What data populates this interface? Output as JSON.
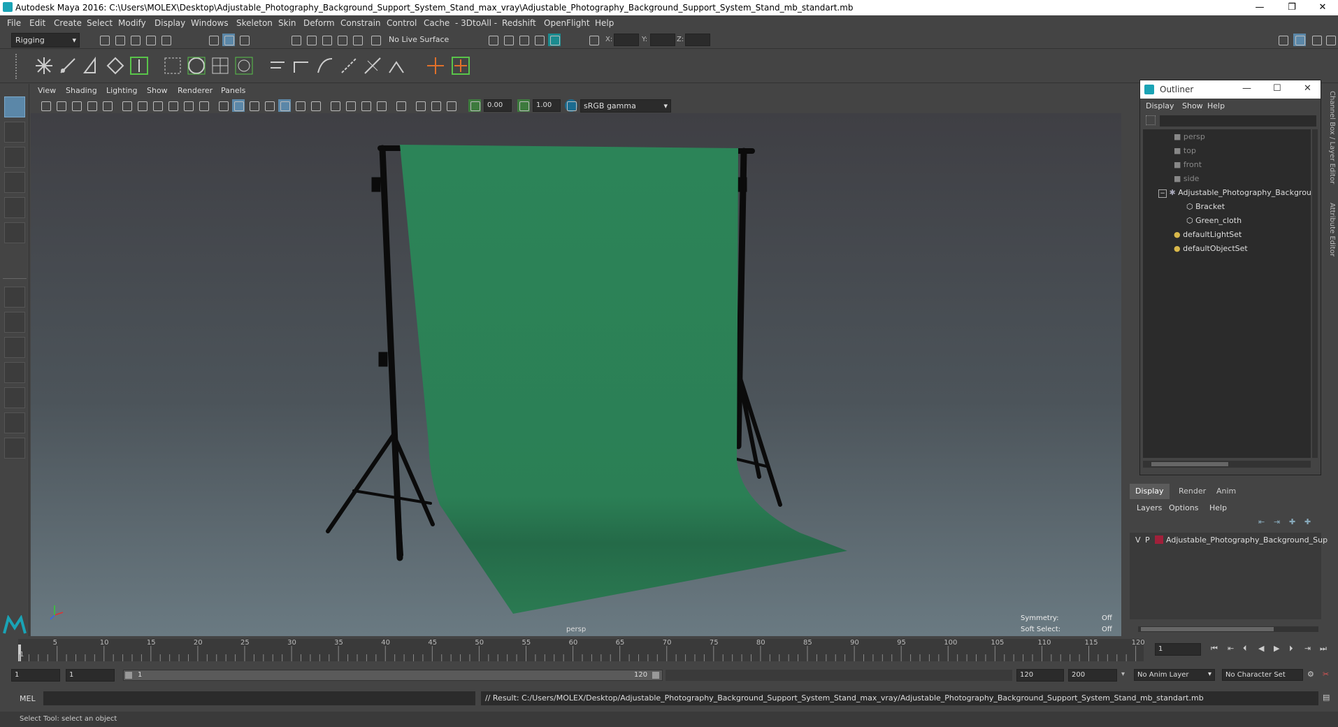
{
  "window": {
    "title": "Autodesk Maya 2016: C:\\Users\\MOLEX\\Desktop\\Adjustable_Photography_Background_Support_System_Stand_max_vray\\Adjustable_Photography_Background_Support_System_Stand_mb_standart.mb",
    "minimize": "—",
    "restore": "❐",
    "close": "✕"
  },
  "menubar": [
    "File",
    "Edit",
    "Create",
    "Select",
    "Modify",
    "Display",
    "Windows",
    "Skeleton",
    "Skin",
    "Deform",
    "Constrain",
    "Control",
    "Cache",
    "- 3DtoAll -",
    "Redshift",
    "OpenFlight",
    "Help"
  ],
  "statusline": {
    "menuset": "Rigging",
    "live_surface": "No Live Surface",
    "x_label": "X:",
    "y_label": "Y:",
    "z_label": "Z:"
  },
  "panel": {
    "menus": [
      "View",
      "Shading",
      "Lighting",
      "Show",
      "Renderer",
      "Panels"
    ],
    "exposure": "0.00",
    "gamma": "1.00",
    "colorspace": "sRGB gamma",
    "camera_label": "persp",
    "symmetry_label": "Symmetry:",
    "symmetry_value": "Off",
    "soft_select_label": "Soft Select:",
    "soft_select_value": "Off"
  },
  "outliner": {
    "title": "Outliner",
    "menus": [
      "Display",
      "Show",
      "Help"
    ],
    "items": [
      {
        "label": "persp",
        "dim": true
      },
      {
        "label": "top",
        "dim": true
      },
      {
        "label": "front",
        "dim": true
      },
      {
        "label": "side",
        "dim": true
      },
      {
        "label": "Adjustable_Photography_Backgrou",
        "dim": false
      },
      {
        "label": "Bracket",
        "dim": false
      },
      {
        "label": "Green_cloth",
        "dim": false
      },
      {
        "label": "defaultLightSet",
        "dim": false
      },
      {
        "label": "defaultObjectSet",
        "dim": false
      }
    ]
  },
  "side_tabs": {
    "channel_box": "Channel Box / Layer Editor",
    "attribute_editor": "Attribute Editor"
  },
  "layer_editor": {
    "tabs": [
      "Display",
      "Render",
      "Anim"
    ],
    "menus": [
      "Layers",
      "Options",
      "Help"
    ],
    "layer": {
      "v": "V",
      "p": "P",
      "name": "Adjustable_Photography_Background_Sup",
      "color": "#a0203a"
    }
  },
  "timeline": {
    "ticks": [
      "5",
      "10",
      "15",
      "20",
      "25",
      "30",
      "35",
      "40",
      "45",
      "50",
      "55",
      "60",
      "65",
      "70",
      "75",
      "80",
      "85",
      "90",
      "95",
      "100",
      "105",
      "110",
      "115",
      "120"
    ],
    "current_frame_tick": "1",
    "current_frame_field": "1"
  },
  "range": {
    "start": "1",
    "playback_start": "1",
    "slider_start": "1",
    "slider_end": "120",
    "playback_end": "120",
    "end": "200",
    "anim_layer": "No Anim Layer",
    "character_set": "No Character Set"
  },
  "command": {
    "language": "MEL",
    "result": "// Result: C:/Users/MOLEX/Desktop/Adjustable_Photography_Background_Support_System_Stand_max_vray/Adjustable_Photography_Background_Support_System_Stand_mb_standart.mb"
  },
  "helpline": "Select Tool: select an object",
  "colors": {
    "cloth": "#2b7f55",
    "accent": "#5b87a8",
    "shelf_green": "#59c44a",
    "shelf_orange": "#e0702a"
  }
}
